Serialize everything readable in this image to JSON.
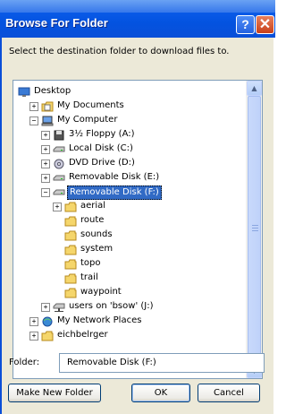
{
  "window": {
    "title": "Browse For Folder",
    "help_glyph": "?",
    "close_glyph": "✕"
  },
  "dialog": {
    "instruction": "Select the destination folder to download files to.",
    "folder_label": "Folder:",
    "folder_value": "Removable Disk (F:)",
    "buttons": {
      "make_new_folder": "Make New Folder",
      "ok": "OK",
      "cancel": "Cancel"
    }
  },
  "tree": {
    "items": [
      {
        "label": "Desktop",
        "level": 0,
        "expander": "",
        "icon": "desktop-icon",
        "selected": false
      },
      {
        "label": "My Documents",
        "level": 1,
        "expander": "+",
        "icon": "documents-icon",
        "selected": false
      },
      {
        "label": "My Computer",
        "level": 1,
        "expander": "−",
        "icon": "computer-icon",
        "selected": false
      },
      {
        "label": "3½ Floppy (A:)",
        "level": 2,
        "expander": "+",
        "icon": "floppy-icon",
        "selected": false
      },
      {
        "label": "Local Disk (C:)",
        "level": 2,
        "expander": "+",
        "icon": "drive-icon",
        "selected": false
      },
      {
        "label": "DVD Drive (D:)",
        "level": 2,
        "expander": "+",
        "icon": "dvd-icon",
        "selected": false
      },
      {
        "label": "Removable Disk (E:)",
        "level": 2,
        "expander": "+",
        "icon": "drive-icon",
        "selected": false
      },
      {
        "label": "Removable Disk (F:)",
        "level": 2,
        "expander": "−",
        "icon": "drive-icon",
        "selected": true
      },
      {
        "label": "aerial",
        "level": 3,
        "expander": "+",
        "icon": "folder-icon",
        "selected": false
      },
      {
        "label": "route",
        "level": 3,
        "expander": "",
        "icon": "folder-icon",
        "selected": false
      },
      {
        "label": "sounds",
        "level": 3,
        "expander": "",
        "icon": "folder-icon",
        "selected": false
      },
      {
        "label": "system",
        "level": 3,
        "expander": "",
        "icon": "folder-icon",
        "selected": false
      },
      {
        "label": "topo",
        "level": 3,
        "expander": "",
        "icon": "folder-icon",
        "selected": false
      },
      {
        "label": "trail",
        "level": 3,
        "expander": "",
        "icon": "folder-icon",
        "selected": false
      },
      {
        "label": "waypoint",
        "level": 3,
        "expander": "",
        "icon": "folder-icon",
        "selected": false
      },
      {
        "label": "users on 'bsow' (J:)",
        "level": 2,
        "expander": "+",
        "icon": "network-drive-icon",
        "selected": false
      },
      {
        "label": "My Network Places",
        "level": 1,
        "expander": "+",
        "icon": "network-places-icon",
        "selected": false
      },
      {
        "label": "eichbelrger",
        "level": 1,
        "expander": "+",
        "icon": "folder-icon",
        "selected": false
      }
    ]
  },
  "colors": {
    "title_bar": "#0353e0",
    "selection": "#316ac5",
    "dialog_bg": "#ece9d8",
    "folder": "#f5d66b"
  }
}
